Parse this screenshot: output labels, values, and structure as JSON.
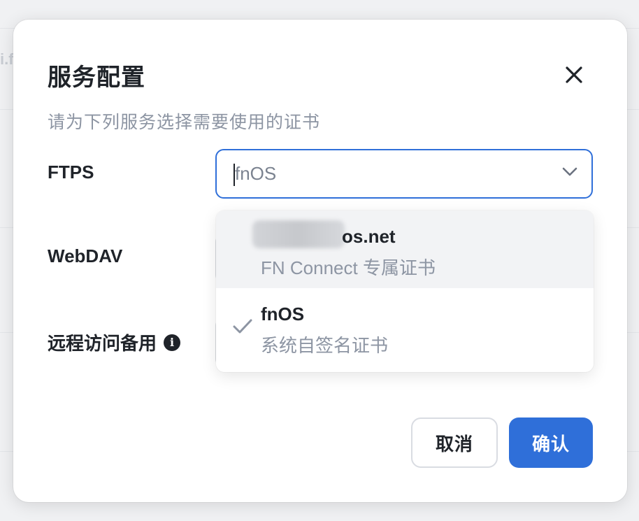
{
  "dialog": {
    "title": "服务配置",
    "subtitle": "请为下列服务选择需要使用的证书",
    "close_icon": "close-icon"
  },
  "rows": [
    {
      "label": "FTPS",
      "value": "fnOS"
    },
    {
      "label": "WebDAV"
    },
    {
      "label": "远程访问备用",
      "info_icon": "info-icon"
    }
  ],
  "dropdown": {
    "options": [
      {
        "name": "os.net",
        "desc": "FN Connect 专属证书",
        "selected": false,
        "hovered": true
      },
      {
        "name": "fnOS",
        "desc": "系统自签名证书",
        "selected": true,
        "hovered": false
      }
    ]
  },
  "buttons": {
    "cancel": "取消",
    "confirm": "确认"
  },
  "colors": {
    "accent": "#2f6fd9",
    "text": "#1f2329",
    "muted": "#8d95a3",
    "check": "#8d95a3"
  }
}
